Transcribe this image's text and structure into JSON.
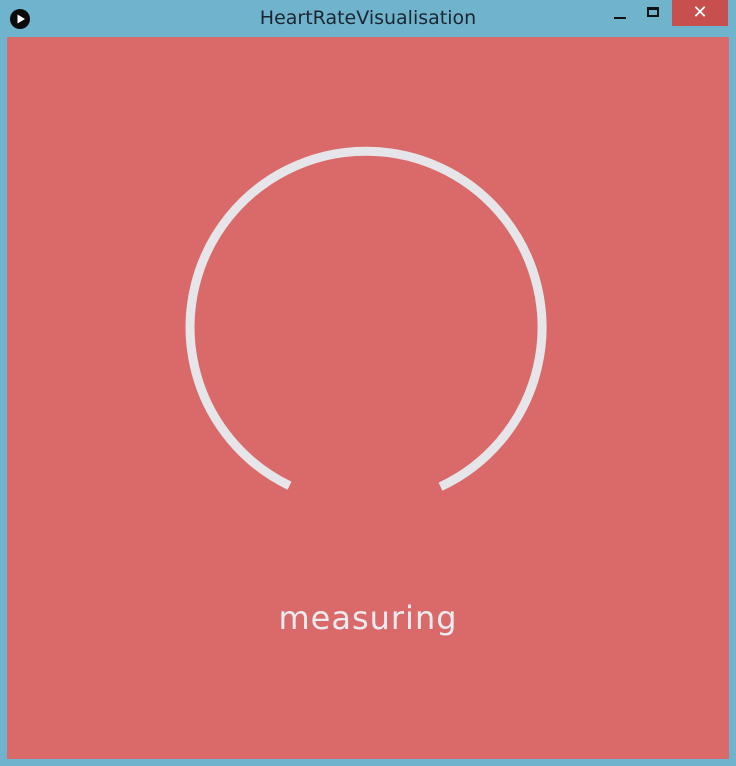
{
  "window": {
    "title": "HeartRateVisualisation",
    "close_glyph": "✕"
  },
  "app": {
    "icon": "play-icon",
    "status": "measuring"
  },
  "colors": {
    "background": "#d96a69",
    "ring": "#e6e6ea",
    "frame": "#6fb3cd",
    "close_button": "#c7504f"
  }
}
